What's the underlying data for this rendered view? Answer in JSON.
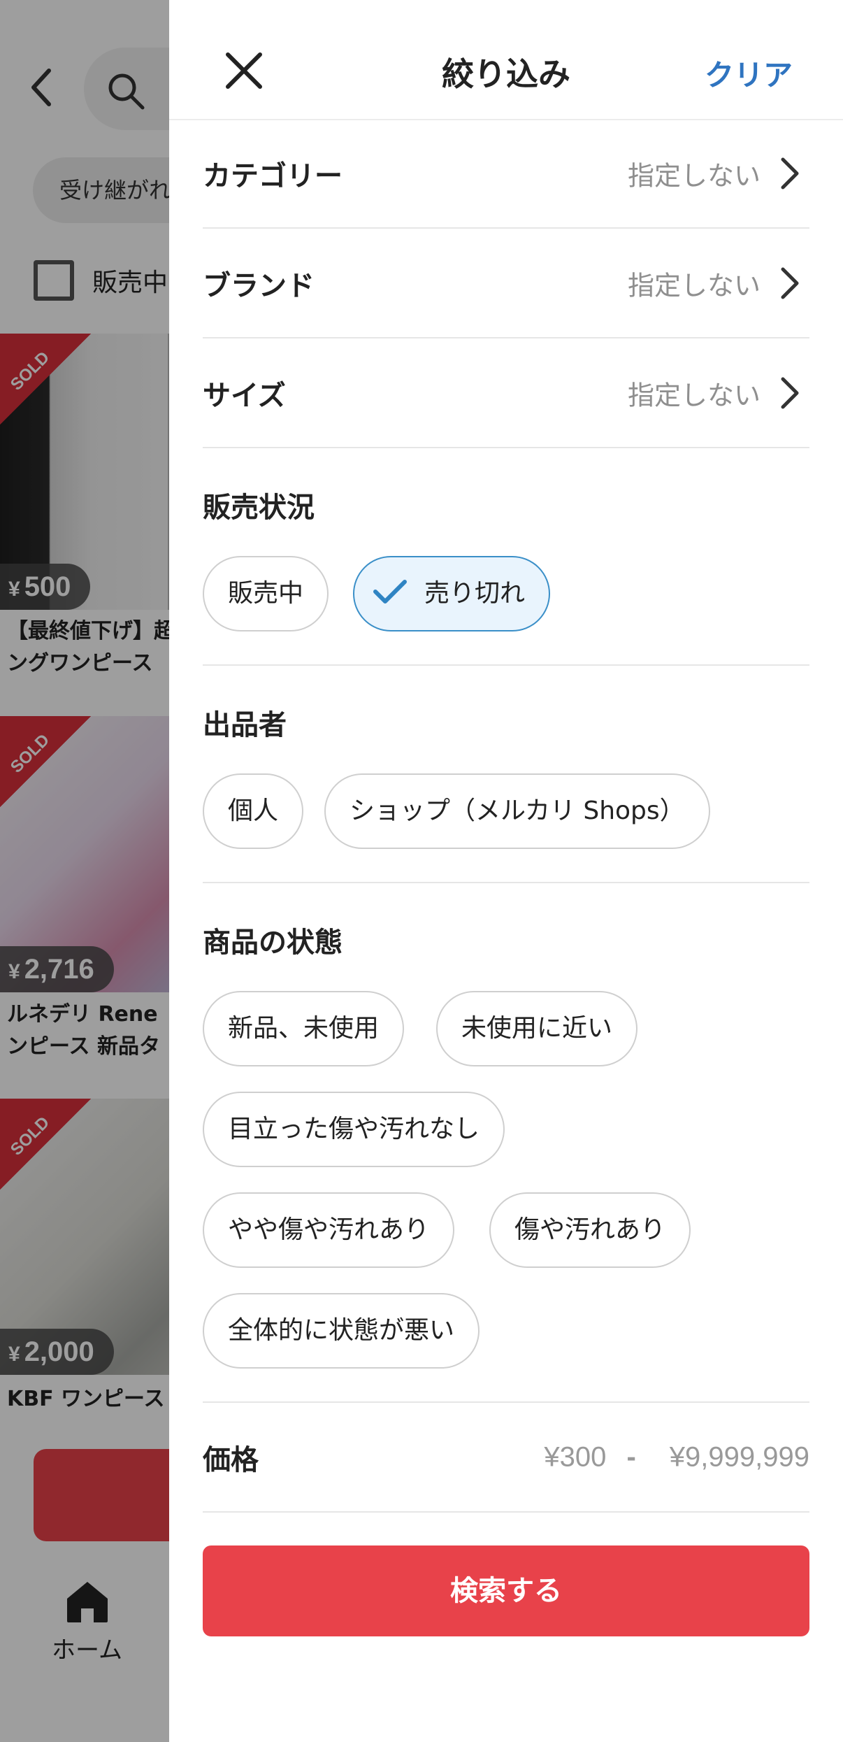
{
  "background": {
    "chip_text": "受け継がれ",
    "checkbox_label": "販売中",
    "items": [
      {
        "sold_badge": "SOLD",
        "price_symbol": "¥",
        "price": "500",
        "title": "【最終値下げ】超\nングワンピース"
      },
      {
        "sold_badge": "SOLD",
        "price_symbol": "¥",
        "price": "2,716",
        "title": "ルネデリ Rene\nンピース 新品タ"
      },
      {
        "sold_badge": "SOLD",
        "price_symbol": "¥",
        "price": "2,000",
        "title": "KBF ワンピース"
      }
    ],
    "nav_home_label": "ホーム"
  },
  "drawer": {
    "title": "絞り込み",
    "clear_label": "クリア",
    "rows": [
      {
        "label": "カテゴリー",
        "value": "指定しない"
      },
      {
        "label": "ブランド",
        "value": "指定しない"
      },
      {
        "label": "サイズ",
        "value": "指定しない"
      }
    ],
    "sales_status": {
      "title": "販売状況",
      "options": [
        {
          "label": "販売中",
          "selected": false
        },
        {
          "label": "売り切れ",
          "selected": true
        }
      ]
    },
    "seller": {
      "title": "出品者",
      "options": [
        {
          "label": "個人",
          "selected": false
        },
        {
          "label": "ショップ（メルカリ Shops）",
          "selected": false
        }
      ]
    },
    "condition": {
      "title": "商品の状態",
      "options": [
        {
          "label": "新品、未使用",
          "selected": false
        },
        {
          "label": "未使用に近い",
          "selected": false
        },
        {
          "label": "目立った傷や汚れなし",
          "selected": false
        },
        {
          "label": "やや傷や汚れあり",
          "selected": false
        },
        {
          "label": "傷や汚れあり",
          "selected": false
        },
        {
          "label": "全体的に状態が悪い",
          "selected": false
        }
      ]
    },
    "price": {
      "label": "価格",
      "min": "¥300",
      "separator": "-",
      "max": "¥9,999,999"
    },
    "search_button_label": "検索する"
  },
  "colors": {
    "accent_blue": "#2f74c0",
    "selected_border": "#3a8fc8",
    "selected_bg": "#e9f4fd",
    "primary_red": "#e8424a",
    "sold_red": "#d8303a"
  }
}
